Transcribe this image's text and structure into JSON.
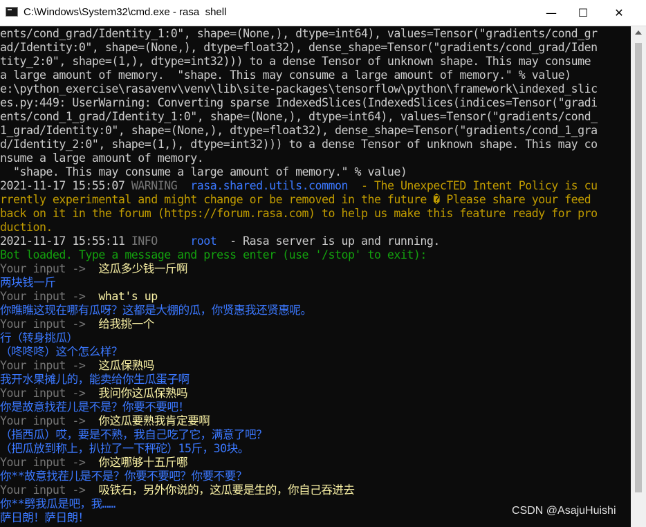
{
  "window": {
    "title": "C:\\Windows\\System32\\cmd.exe - rasa  shell",
    "min_glyph": "—",
    "max_glyph": "☐",
    "close_glyph": "✕"
  },
  "watermark": "CSDN @AsajuHuishi",
  "colors": {
    "default": "#cccccc",
    "timestamp": "#cccccc",
    "warning_label": "#767676",
    "logger": "#3b78ff",
    "warning_msg": "#c19c00",
    "info_label": "#767676",
    "bot_loaded": "#13a10e",
    "prompt": "#767676",
    "user_text": "#f9f1a5",
    "bot_text": "#3b78ff"
  },
  "lines": [
    {
      "segments": [
        {
          "t": "ents/cond_grad/Identity_1:0\", shape=(None,), dtype=int64), values=Tensor(\"gradients/cond_gr",
          "c": "default"
        }
      ]
    },
    {
      "segments": [
        {
          "t": "ad/Identity:0\", shape=(None,), dtype=float32), dense_shape=Tensor(\"gradients/cond_grad/Iden",
          "c": "default"
        }
      ]
    },
    {
      "segments": [
        {
          "t": "tity_2:0\", shape=(1,), dtype=int32))) to a dense Tensor of unknown shape. This may consume",
          "c": "default"
        }
      ]
    },
    {
      "segments": [
        {
          "t": "a large amount of memory.  \"shape. This may consume a large amount of memory.\" % value)",
          "c": "default"
        }
      ]
    },
    {
      "segments": [
        {
          "t": "e:\\python_exercise\\rasavenv\\venv\\lib\\site-packages\\tensorflow\\python\\framework\\indexed_slic",
          "c": "default"
        }
      ]
    },
    {
      "segments": [
        {
          "t": "es.py:449: UserWarning: Converting sparse IndexedSlices(IndexedSlices(indices=Tensor(\"gradi",
          "c": "default"
        }
      ]
    },
    {
      "segments": [
        {
          "t": "ents/cond_1_grad/Identity_1:0\", shape=(None,), dtype=int64), values=Tensor(\"gradients/cond_",
          "c": "default"
        }
      ]
    },
    {
      "segments": [
        {
          "t": "1_grad/Identity:0\", shape=(None,), dtype=float32), dense_shape=Tensor(\"gradients/cond_1_gra",
          "c": "default"
        }
      ]
    },
    {
      "segments": [
        {
          "t": "d/Identity_2:0\", shape=(1,), dtype=int32))) to a dense Tensor of unknown shape. This may co",
          "c": "default"
        }
      ]
    },
    {
      "segments": [
        {
          "t": "nsume a large amount of memory.",
          "c": "default"
        }
      ]
    },
    {
      "segments": [
        {
          "t": "  \"shape. This may consume a large amount of memory.\" % value)",
          "c": "default"
        }
      ]
    },
    {
      "segments": [
        {
          "t": "2021-11-17 15:55:07 ",
          "c": "timestamp"
        },
        {
          "t": "WARNING  ",
          "c": "warning_label"
        },
        {
          "t": "rasa.shared.utils.common",
          "c": "logger"
        },
        {
          "t": "  - The UnexpecTED Intent Policy is cu",
          "c": "warning_msg"
        }
      ]
    },
    {
      "segments": [
        {
          "t": "rrently experimental and might change or be removed in the future � Please share your feed",
          "c": "warning_msg"
        }
      ]
    },
    {
      "segments": [
        {
          "t": "back on it in the forum (https://forum.rasa.com) to help us make this feature ready for pro",
          "c": "warning_msg"
        }
      ]
    },
    {
      "segments": [
        {
          "t": "duction.",
          "c": "warning_msg"
        }
      ]
    },
    {
      "segments": [
        {
          "t": "2021-11-17 15:55:11 ",
          "c": "timestamp"
        },
        {
          "t": "INFO     ",
          "c": "info_label"
        },
        {
          "t": "root",
          "c": "logger"
        },
        {
          "t": "  - Rasa server is up and running.",
          "c": "default"
        }
      ]
    },
    {
      "segments": [
        {
          "t": "Bot loaded. Type a message and press enter (use '/stop' to exit):",
          "c": "bot_loaded"
        }
      ]
    },
    {
      "segments": [
        {
          "t": "Your input ->  ",
          "c": "prompt"
        },
        {
          "t": "这瓜多少钱一斤啊",
          "c": "user_text"
        }
      ]
    },
    {
      "segments": [
        {
          "t": "两块钱一斤",
          "c": "bot_text"
        }
      ]
    },
    {
      "segments": [
        {
          "t": "Your input ->  ",
          "c": "prompt"
        },
        {
          "t": "what's up",
          "c": "user_text"
        }
      ]
    },
    {
      "segments": [
        {
          "t": "你瞧瞧这现在哪有瓜呀？这都是大棚的瓜，你贤惠我还贤惠呢。",
          "c": "bot_text"
        }
      ]
    },
    {
      "segments": [
        {
          "t": "Your input ->  ",
          "c": "prompt"
        },
        {
          "t": "给我挑一个",
          "c": "user_text"
        }
      ]
    },
    {
      "segments": [
        {
          "t": "行（转身挑瓜）",
          "c": "bot_text"
        }
      ]
    },
    {
      "segments": [
        {
          "t": "（咚咚咚）这个怎么样？",
          "c": "bot_text"
        }
      ]
    },
    {
      "segments": [
        {
          "t": "Your input ->  ",
          "c": "prompt"
        },
        {
          "t": "这瓜保熟吗",
          "c": "user_text"
        }
      ]
    },
    {
      "segments": [
        {
          "t": "我开水果摊儿的，能卖给你生瓜蛋子啊",
          "c": "bot_text"
        }
      ]
    },
    {
      "segments": [
        {
          "t": "Your input ->  ",
          "c": "prompt"
        },
        {
          "t": "我问你这瓜保熟吗",
          "c": "user_text"
        }
      ]
    },
    {
      "segments": [
        {
          "t": "你是故意找茬儿是不是？你要不要吧！",
          "c": "bot_text"
        }
      ]
    },
    {
      "segments": [
        {
          "t": "Your input ->  ",
          "c": "prompt"
        },
        {
          "t": "你这瓜要熟我肯定要啊",
          "c": "user_text"
        }
      ]
    },
    {
      "segments": [
        {
          "t": "（指西瓜）哎，要是不熟，我自己吃了它，满意了吧？",
          "c": "bot_text"
        }
      ]
    },
    {
      "segments": [
        {
          "t": "（把瓜放到称上，扒拉了一下秤砣）15斤，30块。",
          "c": "bot_text"
        }
      ]
    },
    {
      "segments": [
        {
          "t": "Your input ->  ",
          "c": "prompt"
        },
        {
          "t": "你这哪够十五斤哪",
          "c": "user_text"
        }
      ]
    },
    {
      "segments": [
        {
          "t": "你**故意找茬儿是不是？你要不要吧？你要不要？",
          "c": "bot_text"
        }
      ]
    },
    {
      "segments": [
        {
          "t": "Your input ->  ",
          "c": "prompt"
        },
        {
          "t": "吸铁石，另外你说的，这瓜要是生的，你自己吞进去",
          "c": "user_text"
        }
      ]
    },
    {
      "segments": [
        {
          "t": "你**劈我瓜是吧，我……",
          "c": "bot_text"
        }
      ]
    },
    {
      "segments": [
        {
          "t": "萨日朗！萨日朗！",
          "c": "bot_text"
        }
      ]
    }
  ]
}
